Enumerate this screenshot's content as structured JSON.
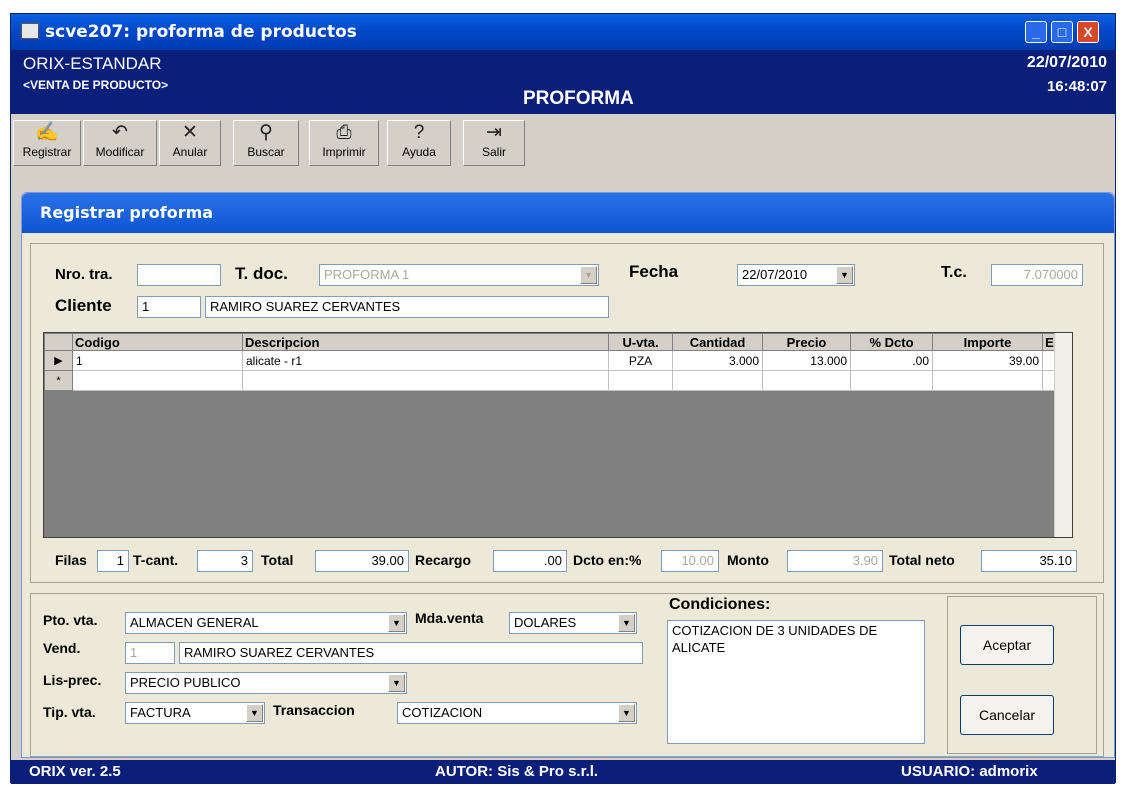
{
  "window": {
    "title": "scve207: proforma de productos",
    "min": "_",
    "max": "□",
    "close": "X"
  },
  "header": {
    "company": "ORIX-ESTANDAR",
    "subtitle": "<VENTA DE PRODUCTO>",
    "title": "PROFORMA",
    "date": "22/07/2010",
    "time": "16:48:07"
  },
  "toolbar": [
    {
      "label": "Registrar",
      "icon": "✍"
    },
    {
      "label": "Modificar",
      "icon": "↶"
    },
    {
      "label": "Anular",
      "icon": "✕"
    },
    {
      "label": "Buscar",
      "icon": "⚲"
    },
    {
      "label": "Imprimir",
      "icon": "⎙"
    },
    {
      "label": "Ayuda",
      "icon": "?"
    },
    {
      "label": "Salir",
      "icon": "⇥"
    }
  ],
  "panel_title": "Registrar proforma",
  "form": {
    "nro_tra_label": "Nro. tra.",
    "nro_tra": "",
    "tdoc_label": "T. doc.",
    "tdoc": "PROFORMA 1",
    "fecha_label": "Fecha",
    "fecha": "22/07/2010",
    "tc_label": "T.c.",
    "tc": "7.070000",
    "cliente_label": "Cliente",
    "cliente_code": "1",
    "cliente_name": "RAMIRO SUAREZ CERVANTES"
  },
  "grid": {
    "columns": [
      "Codigo",
      "Descripcion",
      "U-vta.",
      "Cantidad",
      "Precio",
      "% Dcto",
      "Importe",
      "E"
    ],
    "rows": [
      {
        "marker": "▶",
        "codigo": "1",
        "descripcion": "alicate - r1",
        "uvta": "PZA",
        "cantidad": "3.000",
        "precio": "13.000",
        "dcto": ".00",
        "importe": "39.00"
      },
      {
        "marker": "*",
        "codigo": "",
        "descripcion": "",
        "uvta": "",
        "cantidad": "",
        "precio": "",
        "dcto": "",
        "importe": ""
      }
    ]
  },
  "totals": {
    "filas_label": "Filas",
    "filas": "1",
    "tcant_label": "T-cant.",
    "tcant": "3",
    "total_label": "Total",
    "total": "39.00",
    "recargo_label": "Recargo",
    "recargo": ".00",
    "dcto_label": "Dcto en:%",
    "dcto": "10.00",
    "monto_label": "Monto",
    "monto": "3.90",
    "neto_label": "Total neto",
    "neto": "35.10"
  },
  "bottom": {
    "ptovta_label": "Pto. vta.",
    "ptovta": "ALMACEN GENERAL",
    "mda_label": "Mda.venta",
    "mda": "DOLARES",
    "vend_label": "Vend.",
    "vend_code": "1",
    "vend_name": "RAMIRO SUAREZ CERVANTES",
    "lisprec_label": "Lis-prec.",
    "lisprec": "PRECIO PUBLICO",
    "tipvta_label": "Tip. vta.",
    "tipvta": "FACTURA",
    "trans_label": "Transaccion",
    "trans": "COTIZACION",
    "condiciones_label": "Condiciones:",
    "condiciones": "COTIZACION DE 3 UNIDADES DE ALICATE"
  },
  "buttons": {
    "aceptar": "Aceptar",
    "cancelar": "Cancelar"
  },
  "status": {
    "version": "ORIX ver. 2.5",
    "autor": "AUTOR: Sis & Pro s.r.l.",
    "usuario": "USUARIO: admorix"
  }
}
